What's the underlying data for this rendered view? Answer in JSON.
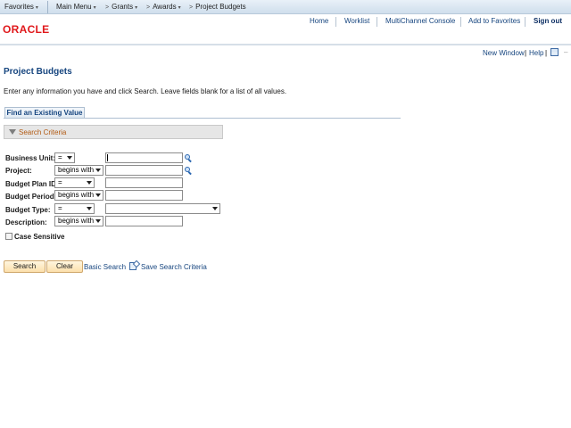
{
  "topnav": {
    "favorites": "Favorites",
    "main_menu": "Main Menu",
    "breadcrumbs": [
      "Grants",
      "Awards",
      "Project Budgets"
    ],
    "arrow": ">",
    "caret": "▾"
  },
  "header": {
    "logo": "ORACLE",
    "nav": [
      "Home",
      "Worklist",
      "MultiChannel Console",
      "Add to Favorites",
      "Sign out"
    ]
  },
  "util": {
    "new_window": "New Window",
    "separator": "|",
    "help": "Help",
    "grid_icon": "grid-icon"
  },
  "page": {
    "title": "Project Budgets",
    "instruction": "Enter any information you have and click Search. Leave fields blank for a list of all values.",
    "tab": "Find an Existing Value",
    "section": "Search Criteria"
  },
  "fields": [
    {
      "label": "Business Unit:",
      "operator": "=",
      "value": ""
    },
    {
      "label": "Project:",
      "operator": "begins with",
      "value": ""
    },
    {
      "label": "Budget Plan ID:",
      "operator": "=",
      "value": ""
    },
    {
      "label": "Budget Period:",
      "operator": "begins with",
      "value": ""
    },
    {
      "label": "Budget Type:",
      "operator": "=",
      "value": ""
    },
    {
      "label": "Description:",
      "operator": "begins with",
      "value": ""
    }
  ],
  "case_sensitive": {
    "label": "Case Sensitive",
    "checked": false
  },
  "actions": {
    "search": "Search",
    "clear": "Clear",
    "basic_search": "Basic Search",
    "save_criteria": "Save Search Criteria"
  },
  "colors": {
    "oracle_red": "#e0181b",
    "link_blue": "#16457f",
    "section_orange": "#b25a12",
    "button_fill": "#fcdfab"
  }
}
